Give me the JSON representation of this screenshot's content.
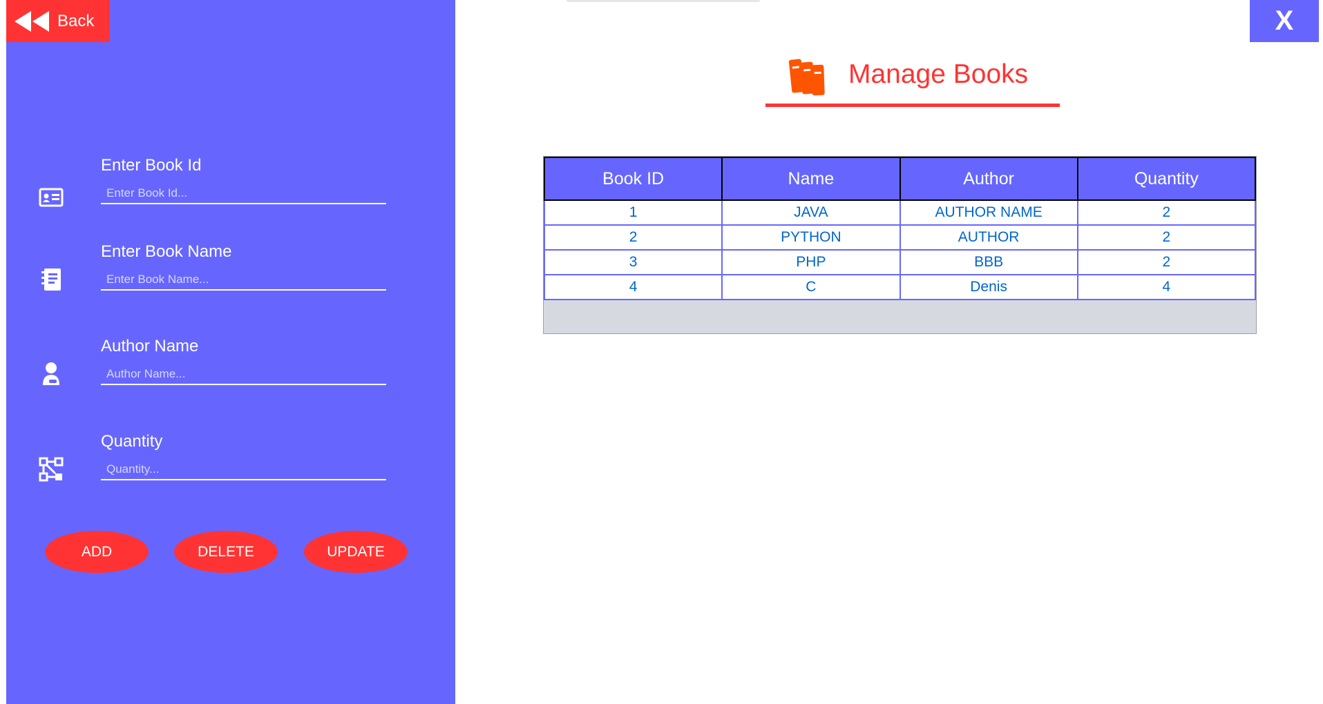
{
  "back": {
    "label": "Back"
  },
  "close": {
    "label": "X"
  },
  "header": {
    "title": "Manage Books"
  },
  "form": {
    "book_id": {
      "label": "Enter Book Id",
      "placeholder": "Enter Book Id...",
      "value": ""
    },
    "book_name": {
      "label": "Enter Book Name",
      "placeholder": "Enter Book Name...",
      "value": ""
    },
    "author": {
      "label": "Author Name",
      "placeholder": "Author Name...",
      "value": ""
    },
    "quantity": {
      "label": "Quantity",
      "placeholder": "Quantity...",
      "value": ""
    }
  },
  "actions": {
    "add": "ADD",
    "delete": "DELETE",
    "update": "UPDATE"
  },
  "table": {
    "headers": [
      "Book ID",
      "Name",
      "Author",
      "Quantity"
    ],
    "rows": [
      [
        "1",
        "JAVA",
        "AUTHOR NAME",
        "2"
      ],
      [
        "2",
        "PYTHON",
        "AUTHOR",
        "2"
      ],
      [
        "3",
        "PHP",
        "BBB",
        "2"
      ],
      [
        "4",
        "C",
        "Denis",
        "4"
      ]
    ]
  },
  "colors": {
    "panel": "#6666ff",
    "accent": "#ff3333",
    "cell_text": "#0066cc",
    "icon_orange": "#ff5500"
  },
  "icons": {
    "back": "rewind-icon",
    "book_id": "id-card-icon",
    "book_name": "notebook-icon",
    "author": "person-icon",
    "quantity": "network-icon",
    "header": "books-icon"
  }
}
